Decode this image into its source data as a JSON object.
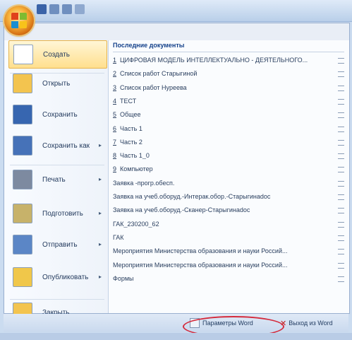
{
  "menu": {
    "commands": [
      {
        "label": "Создать",
        "icon": "new-document-icon",
        "has_arrow": false,
        "active": true
      },
      {
        "label": "Открыть",
        "icon": "open-folder-icon",
        "has_arrow": false
      },
      {
        "label": "Сохранить",
        "icon": "save-disk-icon",
        "has_arrow": false
      },
      {
        "label": "Сохранить как",
        "icon": "save-as-icon",
        "has_arrow": true
      },
      {
        "label": "Печать",
        "icon": "printer-icon",
        "has_arrow": true
      },
      {
        "label": "Подготовить",
        "icon": "prepare-icon",
        "has_arrow": true
      },
      {
        "label": "Отправить",
        "icon": "send-icon",
        "has_arrow": true
      },
      {
        "label": "Опубликовать",
        "icon": "publish-icon",
        "has_arrow": true
      },
      {
        "label": "Закрыть",
        "icon": "close-folder-icon",
        "has_arrow": false
      }
    ]
  },
  "recent": {
    "title": "Последние документы",
    "items": [
      {
        "num": "1",
        "name": "ЦИФРОВАЯ МОДЕЛЬ ИНТЕЛЛЕКТУАЛЬНО - ДЕЯТЕЛЬНОГО..."
      },
      {
        "num": "2",
        "name": "Список работ Старыгиной"
      },
      {
        "num": "3",
        "name": "Список работ Нуреева"
      },
      {
        "num": "4",
        "name": "ТЕСТ"
      },
      {
        "num": "5",
        "name": "Общее"
      },
      {
        "num": "6",
        "name": "Часть 1"
      },
      {
        "num": "7",
        "name": "Часть 2"
      },
      {
        "num": "8",
        "name": "Часть 1_0"
      },
      {
        "num": "9",
        "name": "Компьютер"
      },
      {
        "num": "",
        "name": "Заявка -прогр.обесп."
      },
      {
        "num": "",
        "name": "Заявка на учеб.оборуд.-Интерак.обор.-Старыгинаdoc"
      },
      {
        "num": "",
        "name": "Заявка на учеб.оборуд.-Сканер-Старыгинаdoc"
      },
      {
        "num": "",
        "name": "ГАК_230200_62"
      },
      {
        "num": "",
        "name": "ГАК"
      },
      {
        "num": "",
        "name": "Мероприятия Министерства образования и науки Россий..."
      },
      {
        "num": "",
        "name": "Мероприятия Министерства образования и науки Россий..."
      },
      {
        "num": "",
        "name": "Формы"
      }
    ]
  },
  "footer": {
    "options_label": "Параметры Word",
    "exit_label": "Выход из Word"
  },
  "colors": {
    "accent": "#ffdf8e",
    "highlight_ring": "#d42a3c"
  }
}
